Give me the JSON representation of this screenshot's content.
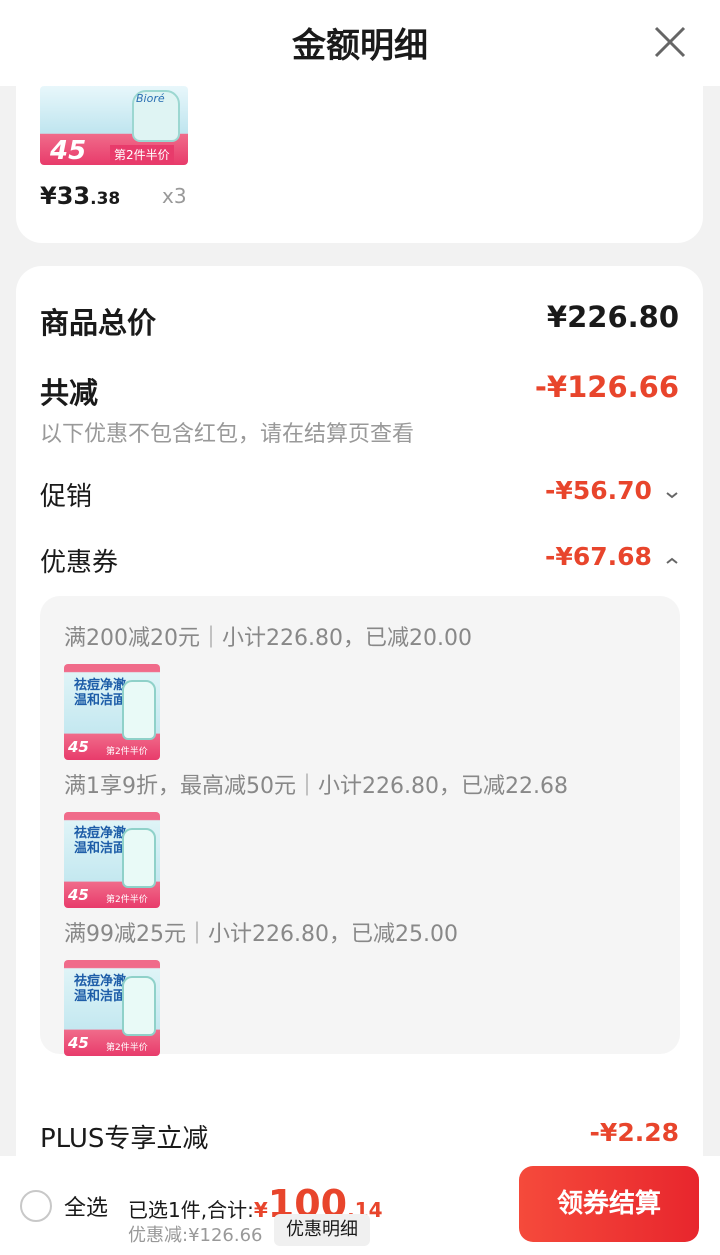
{
  "header": {
    "title": "金额明细",
    "close_icon": "close-icon"
  },
  "product": {
    "image_price": "45",
    "image_brand": "Bioré",
    "image_promo": "第2件半价",
    "unit_price_main": "¥33",
    "unit_price_dec": ".38",
    "quantity": "x3"
  },
  "summary": {
    "total_label": "商品总价",
    "total_value": "¥226.80",
    "reduce_label": "共减",
    "reduce_value": "-¥126.66",
    "reduce_note": "以下优惠不包含红包，请在结算页查看",
    "promo_label": "促销",
    "promo_value": "-¥56.70",
    "coupon_label": "优惠券",
    "coupon_value": "-¥67.68",
    "plus_label": "PLUS专享立减",
    "plus_value": "-¥2.28"
  },
  "coupons": [
    {
      "text": "满200减20元｜小计226.80，已减20.00",
      "thumb_title": "祛痘净澈温和洁面",
      "thumb_price": "45",
      "thumb_promo": "第2件半价"
    },
    {
      "text": "满1享9折，最高减50元｜小计226.80，已减22.68",
      "thumb_title": "祛痘净澈温和洁面",
      "thumb_price": "45",
      "thumb_promo": "第2件半价"
    },
    {
      "text": "满99减25元｜小计226.80，已减25.00",
      "thumb_title": "祛痘净澈温和洁面",
      "thumb_price": "45",
      "thumb_promo": "第2件半价"
    }
  ],
  "footer": {
    "select_all": "全选",
    "selected_text": "已选1件,合计:",
    "currency": "¥",
    "total_int": "100",
    "total_dec": ".14",
    "discount_text": "优惠减:¥126.66",
    "detail_button": "优惠明细",
    "checkout_button": "领券结算"
  },
  "colors": {
    "accent_red": "#e8452c",
    "checkout_gradient": [
      "#f54a3b",
      "#e8262d"
    ]
  }
}
